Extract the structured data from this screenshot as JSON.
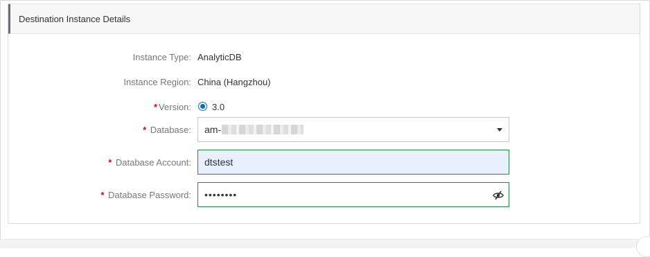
{
  "panel": {
    "title": "Destination Instance Details"
  },
  "fields": {
    "instance_type": {
      "label": "Instance Type:",
      "value": "AnalyticDB"
    },
    "instance_region": {
      "label": "Instance Region:",
      "value": "China (Hangzhou)"
    },
    "version": {
      "required": "*",
      "label": "Version:",
      "selected": "3.0"
    },
    "database": {
      "required": "*",
      "label": " Database:",
      "value_prefix": "am-"
    },
    "database_account": {
      "required": "*",
      "label": " Database Account:",
      "value": "dtstest"
    },
    "database_password": {
      "required": "*",
      "label": " Database Password:",
      "value": "••••••••"
    }
  },
  "icons": {
    "select_caret": "chevron-down-icon",
    "password_toggle": "eye-slash-icon"
  },
  "colors": {
    "required": "#d9001b",
    "radio": "#0070cc",
    "active_border": "#1e8e3e",
    "autofill_bg": "#e8f0fe"
  }
}
